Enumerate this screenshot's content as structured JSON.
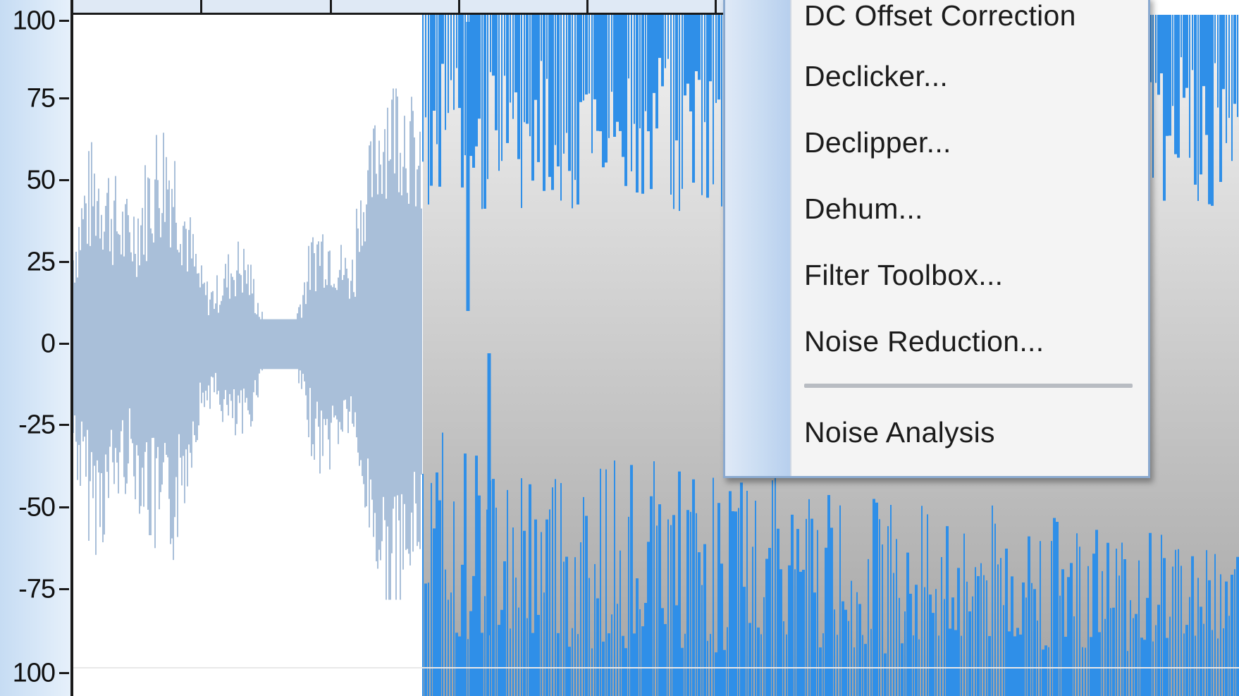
{
  "amplitude_ruler": {
    "labels": [
      "100",
      "75",
      "50",
      "25",
      "0",
      "-25",
      "-50",
      "-75",
      "100"
    ]
  },
  "waveform": {
    "unselected_color": "#a9bfd9",
    "selected_color": "#2f8fe8",
    "selection_background_top": "#f2f2f2",
    "selection_background_bottom": "#a4a4a4"
  },
  "context_menu": {
    "items": [
      {
        "label": "DC Offset Correction"
      },
      {
        "label": "Declicker..."
      },
      {
        "label": "Declipper..."
      },
      {
        "label": "Dehum..."
      },
      {
        "label": "Filter Toolbox..."
      },
      {
        "label": "Noise Reduction..."
      },
      {
        "label": "Noise Analysis"
      }
    ]
  }
}
